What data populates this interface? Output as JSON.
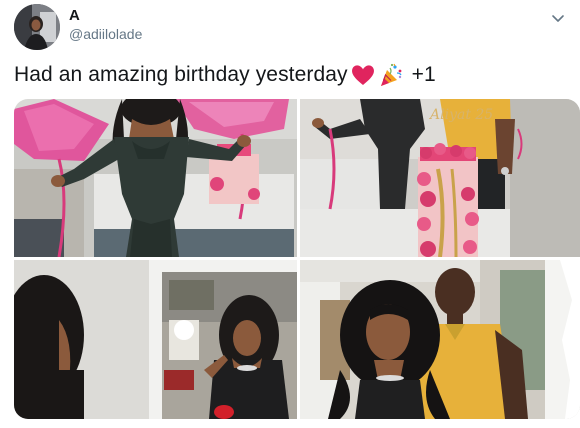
{
  "author": {
    "display_name": "A",
    "handle": "@adiilolade",
    "avatar_icon": "profile-photo"
  },
  "tweet": {
    "text": "Had an amazing birthday yesterday",
    "emojis": [
      "red-heart-emoji",
      "party-popper-emoji"
    ],
    "extra_count": "+1"
  },
  "media": {
    "photos": [
      {
        "icon": "photo-woman-with-balloons-and-cake"
      },
      {
        "icon": "photo-birthday-cake-with-roses"
      },
      {
        "icon": "photo-woman-in-mirror"
      },
      {
        "icon": "photo-couple-selfie"
      }
    ],
    "cake_topper_text": "Aliyat 25"
  },
  "colors": {
    "text": "#14171a",
    "secondary_text": "#657786",
    "heart": "#e0245e",
    "balloon_pink": "#e0569c",
    "shirt_yellow": "#e7b13a"
  }
}
